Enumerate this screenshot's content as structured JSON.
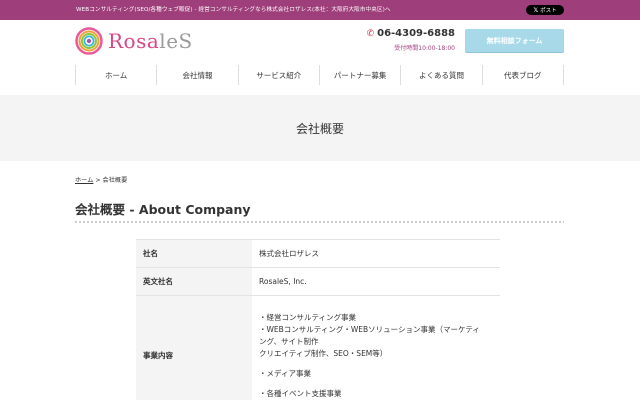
{
  "topbar": {
    "text": "WEBコンサルティング(SEO/各種ウェブ販促) - 経営コンサルティングなら株式会社ロザレス(本社：大阪府大阪市中央区)へ",
    "post_button": "ポスト",
    "post_icon": "x-logo-icon"
  },
  "header": {
    "logo_text_pink": "Rosa",
    "logo_text_gray": "leS",
    "phone_number": "06-4309-6888",
    "phone_hours": "受付時間10:00-18:00",
    "cta_label": "無料相談フォーム"
  },
  "nav": {
    "items": [
      "ホーム",
      "会社情報",
      "サービス紹介",
      "パートナー募集",
      "よくある質問",
      "代表ブログ"
    ]
  },
  "hero": {
    "title": "会社概要"
  },
  "breadcrumb": {
    "home": "ホーム",
    "separator": " > ",
    "current": "会社概要"
  },
  "section": {
    "title": "会社概要 - About Company"
  },
  "company_table": {
    "rows": [
      {
        "label": "社名",
        "value": "株式会社ロザレス"
      },
      {
        "label": "英文社名",
        "value": "RosaleS, Inc."
      },
      {
        "label": "事業内容",
        "lines": [
          "・経営コンサルティング事業",
          "・WEBコンサルティング・WEBソリューション事業（マーケティ",
          "ング、サイト制作",
          "クリエイティブ制作、SEO・SEM等）",
          "・メディア事業",
          "・各種イベント支援事業"
        ]
      }
    ]
  },
  "colors": {
    "topbar": "#9e3f7b",
    "cta": "#a7d9e8",
    "logo_pink": "#d74787",
    "hero_bg": "#f4f4f4"
  }
}
